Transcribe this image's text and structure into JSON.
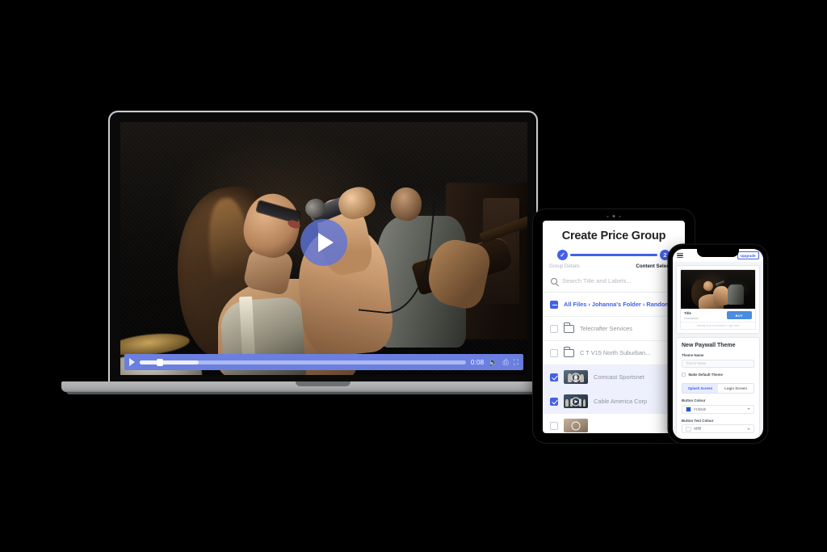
{
  "laptop": {
    "video": {
      "play_overlay_icon": "play-circle-icon",
      "controls": {
        "play_icon": "play-icon",
        "time": "0:08",
        "volume_icon": "volume-icon",
        "captions_icon": "captions-icon",
        "fullscreen_icon": "fullscreen-icon"
      }
    }
  },
  "tablet": {
    "title": "Create Price Group",
    "steps": [
      {
        "marker": "✓",
        "label": "Group Details",
        "state": "complete"
      },
      {
        "marker": "2",
        "label": "Content Selection",
        "state": "active"
      }
    ],
    "search": {
      "icon": "search-icon",
      "placeholder": "Search Title and Labels..."
    },
    "breadcrumb": "All Files › Johanna's Folder › Random",
    "rows": [
      {
        "label": "Telecrafter Services",
        "type": "folder",
        "checked": false
      },
      {
        "label": "C T V15 North Suburban...",
        "type": "folder",
        "checked": false
      },
      {
        "label": "Comcast Sportsnet",
        "type": "video",
        "checked": true
      },
      {
        "label": "Cable America Corp",
        "type": "video",
        "checked": true
      }
    ]
  },
  "phone": {
    "topbar": {
      "menu_icon": "hamburger-menu-icon",
      "upgrade_label": "Upgrade"
    },
    "preview": {
      "title": "Title",
      "description": "Description",
      "buy_label": "BUY",
      "footer": "Already have an account? Login here"
    },
    "panel": {
      "heading": "New Paywall Theme",
      "theme_name_label": "Theme Name",
      "theme_name_placeholder": "Theme Name",
      "default_theme_label": "Make Default Theme",
      "tabs": [
        {
          "label": "Splash Screen",
          "active": true
        },
        {
          "label": "Login Screen",
          "active": false
        }
      ],
      "button_colour_label": "Button Colour",
      "button_colour_value": "#1f59d0",
      "button_text_colour_label": "Button Text Colour",
      "button_text_colour_value": "#ffffff"
    }
  },
  "colors": {
    "accent": "#4361e8",
    "player_bar": "#6b7fe0",
    "buy_button": "#4a8ce0",
    "background": "#000000"
  }
}
